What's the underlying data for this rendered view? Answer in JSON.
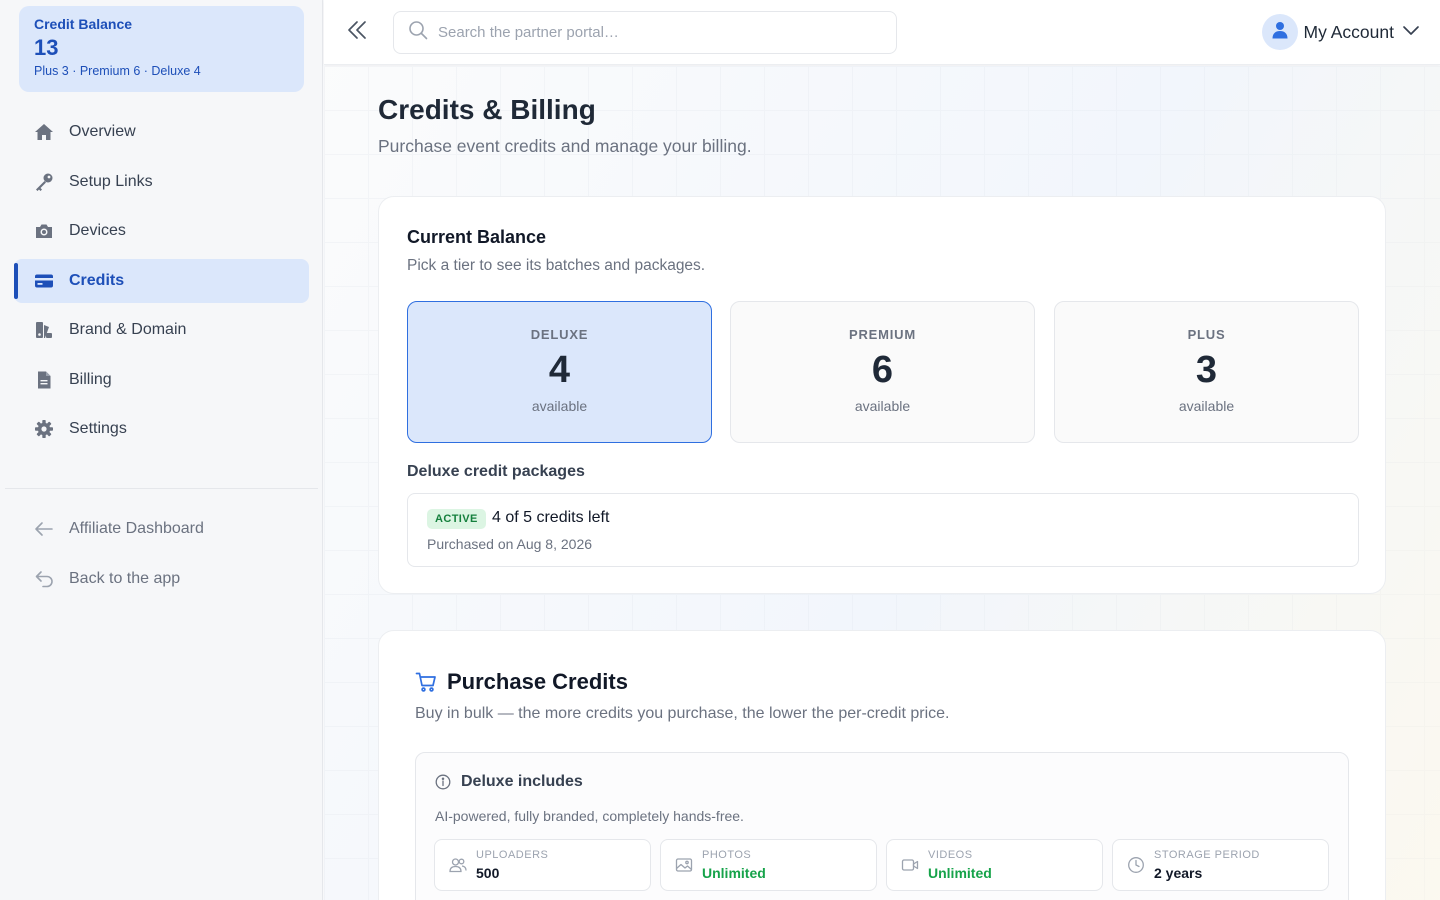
{
  "sidebar": {
    "balance": {
      "label": "Credit Balance",
      "value": "13",
      "breakdown": "Plus 3 · Premium 6 · Deluxe 4"
    },
    "items": [
      {
        "label": "Overview",
        "icon": "home-icon"
      },
      {
        "label": "Setup Links",
        "icon": "key-icon"
      },
      {
        "label": "Devices",
        "icon": "camera-icon"
      },
      {
        "label": "Credits",
        "icon": "credit-card-icon",
        "active": true
      },
      {
        "label": "Brand & Domain",
        "icon": "brand-icon"
      },
      {
        "label": "Billing",
        "icon": "document-icon"
      },
      {
        "label": "Settings",
        "icon": "gear-icon"
      }
    ],
    "secondary": [
      {
        "label": "Affiliate Dashboard",
        "icon": "arrow-left-icon"
      },
      {
        "label": "Back to the app",
        "icon": "return-icon"
      }
    ]
  },
  "header": {
    "search_placeholder": "Search the partner portal…",
    "account_label": "My Account"
  },
  "page": {
    "title": "Credits & Billing",
    "subtitle": "Purchase event credits and manage your billing."
  },
  "balance_card": {
    "title": "Current Balance",
    "subtitle": "Pick a tier to see its batches and packages.",
    "tiers": [
      {
        "name": "DELUXE",
        "count": "4",
        "label": "available",
        "selected": true
      },
      {
        "name": "PREMIUM",
        "count": "6",
        "label": "available"
      },
      {
        "name": "PLUS",
        "count": "3",
        "label": "available"
      }
    ],
    "packages_title": "Deluxe credit packages",
    "package": {
      "status": "ACTIVE",
      "credits": "4 of 5 credits left",
      "date": "Purchased on Aug 8, 2026"
    }
  },
  "purchase": {
    "title": "Purchase Credits",
    "subtitle": "Buy in bulk — the more credits you purchase, the lower the per-credit price.",
    "includes_title": "Deluxe includes",
    "includes_desc": "AI-powered, fully branded, completely hands-free.",
    "features": [
      {
        "label": "UPLOADERS",
        "value": "500",
        "icon": "users-icon"
      },
      {
        "label": "PHOTOS",
        "value": "Unlimited",
        "icon": "image-icon"
      },
      {
        "label": "VIDEOS",
        "value": "Unlimited",
        "icon": "video-icon"
      },
      {
        "label": "STORAGE PERIOD",
        "value": "2 years",
        "icon": "clock-icon"
      }
    ]
  },
  "colors": {
    "accent": "#1d4fb8",
    "accent_light": "#dbe7fb",
    "success": "#16a34a"
  }
}
